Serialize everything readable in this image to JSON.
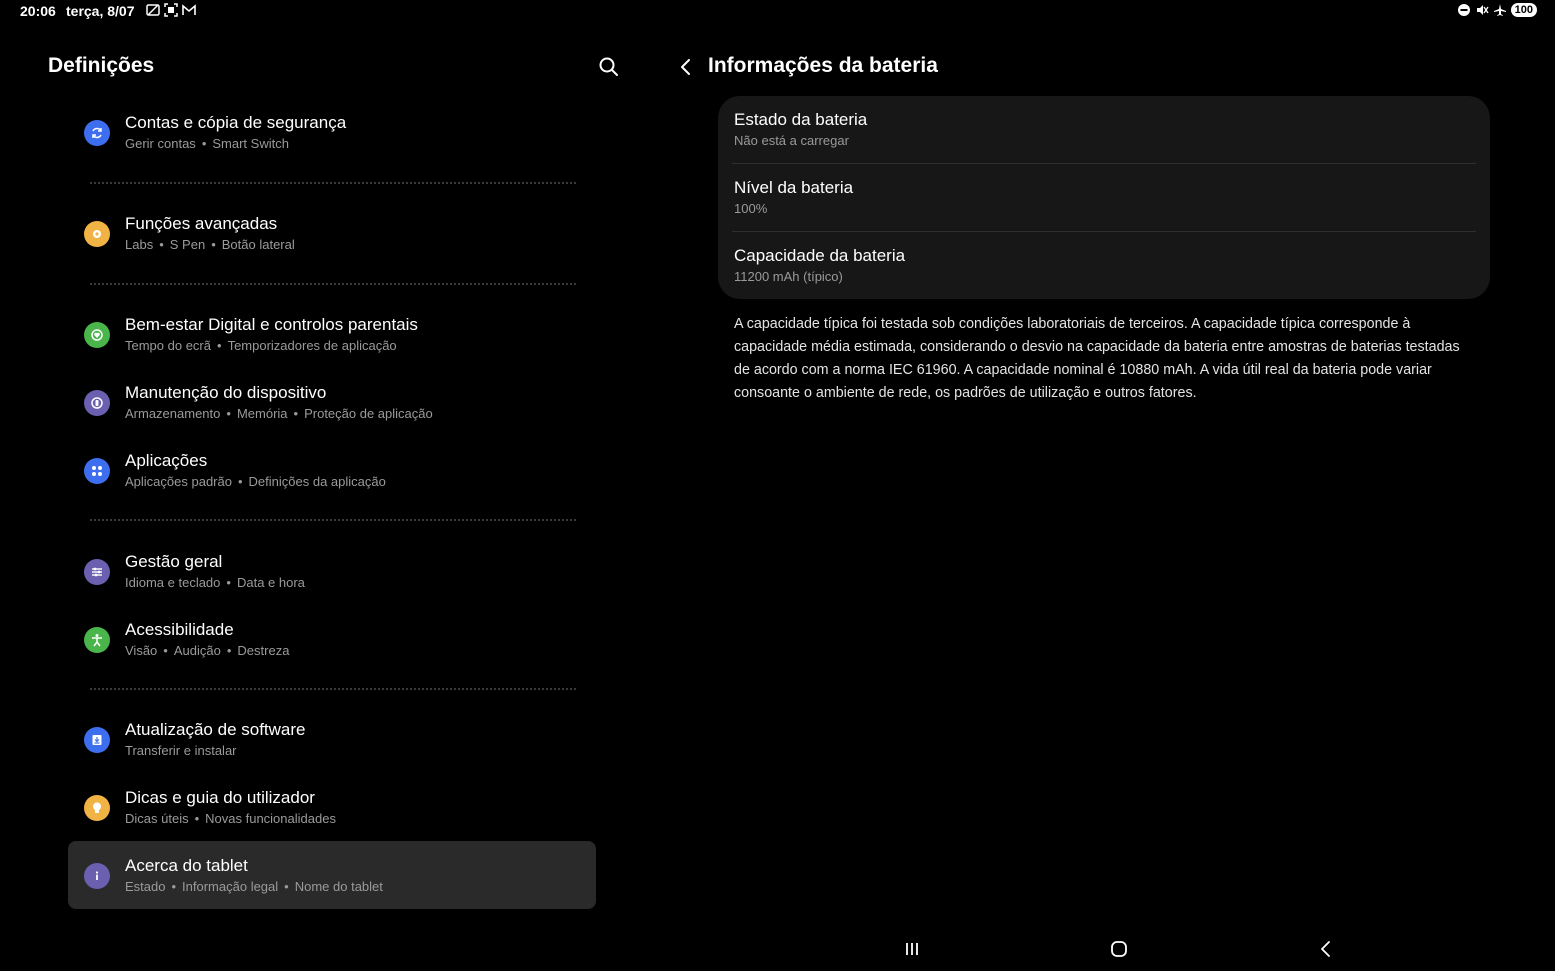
{
  "status_bar": {
    "time": "20:06",
    "date": "terça, 8/07",
    "battery": "100",
    "left_icons": [
      "wifi-off-icon",
      "screenshot-icon",
      "gmail-icon"
    ],
    "right_icons": [
      "do-not-disturb-icon",
      "mute-icon",
      "airplane-mode-icon"
    ]
  },
  "left_pane": {
    "title": "Definições",
    "search_icon": "search-icon",
    "items": [
      {
        "title": "Contas e cópia de segurança",
        "sub": [
          "Gerir contas",
          "Smart Switch"
        ],
        "icon": "sync-icon",
        "color": "#3e6ef0"
      },
      {
        "title": "Funções avançadas",
        "sub": [
          "Labs",
          "S Pen",
          "Botão lateral"
        ],
        "icon": "gear-plus-icon",
        "color": "#f2b345"
      },
      {
        "title": "Bem-estar Digital e controlos parentais",
        "sub": [
          "Tempo do ecrã",
          "Temporizadores de aplicação"
        ],
        "icon": "wellbeing-icon",
        "color": "#49b54a"
      },
      {
        "title": "Manutenção do dispositivo",
        "sub": [
          "Armazenamento",
          "Memória",
          "Proteção de aplicação"
        ],
        "icon": "device-care-icon",
        "color": "#6b5fb0"
      },
      {
        "title": "Aplicações",
        "sub": [
          "Aplicações padrão",
          "Definições da aplicação"
        ],
        "icon": "apps-grid-icon",
        "color": "#3e6ef0"
      },
      {
        "title": "Gestão geral",
        "sub": [
          "Idioma e teclado",
          "Data e hora"
        ],
        "icon": "sliders-icon",
        "color": "#6b5fb0"
      },
      {
        "title": "Acessibilidade",
        "sub": [
          "Visão",
          "Audição",
          "Destreza"
        ],
        "icon": "accessibility-icon",
        "color": "#49b54a"
      },
      {
        "title": "Atualização de software",
        "sub": [
          "Transferir e instalar"
        ],
        "icon": "software-update-icon",
        "color": "#3e6ef0"
      },
      {
        "title": "Dicas e guia do utilizador",
        "sub": [
          "Dicas úteis",
          "Novas funcionalidades"
        ],
        "icon": "lightbulb-icon",
        "color": "#f2b345"
      },
      {
        "title": "Acerca do tablet",
        "sub": [
          "Estado",
          "Informação legal",
          "Nome do tablet"
        ],
        "icon": "info-icon",
        "color": "#6b5fb0",
        "selected": true
      }
    ]
  },
  "right_pane": {
    "title": "Informações da bateria",
    "back_icon": "back-icon",
    "rows": [
      {
        "title": "Estado da bateria",
        "sub": "Não está a carregar"
      },
      {
        "title": "Nível da bateria",
        "sub": "100%"
      },
      {
        "title": "Capacidade da bateria",
        "sub": "11200 mAh (típico)"
      }
    ],
    "note": "A capacidade típica foi testada sob condições laboratoriais de terceiros. A capacidade típica corresponde à capacidade média estimada, considerando o desvio na capacidade da bateria entre amostras de baterias testadas de acordo com a norma IEC 61960. A capacidade nominal é 10880 mAh. A vida útil real da bateria pode variar consoante o ambiente de rede, os padrões de utilização e outros fatores."
  },
  "nav_bar": {
    "buttons": [
      "recent-apps-icon",
      "home-icon",
      "back-nav-icon"
    ]
  }
}
